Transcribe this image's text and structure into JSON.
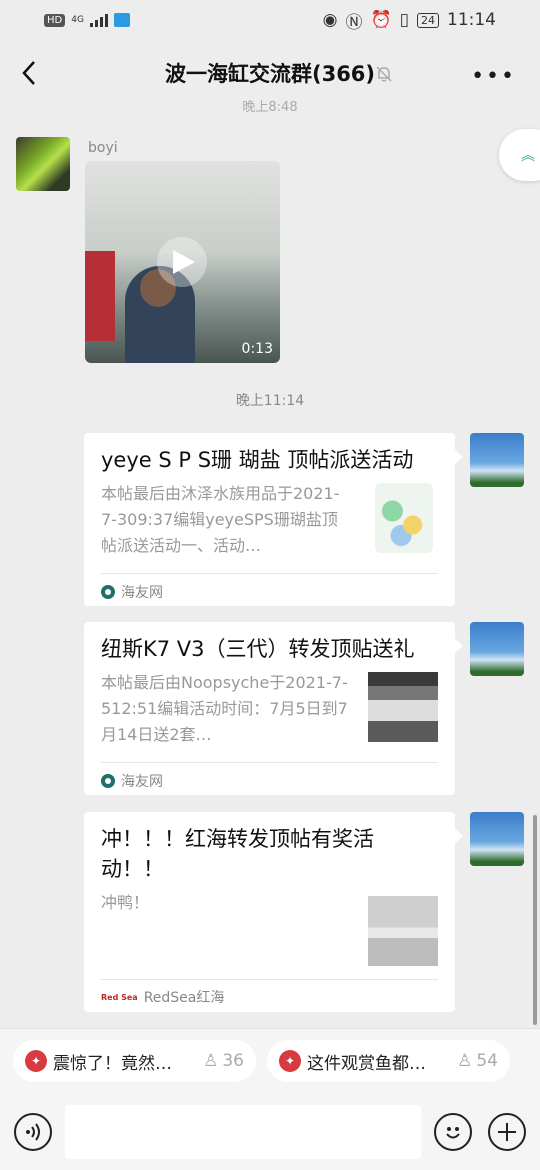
{
  "status": {
    "time": "11:14",
    "battery": "24",
    "hd": "HD",
    "net": "4G"
  },
  "header": {
    "title": "波一海缸交流群(366)"
  },
  "ghost_time": "晚上8:48",
  "messages": {
    "sender": "boyi",
    "video_duration": "0:13",
    "timestamp": "晚上11:14"
  },
  "cards": [
    {
      "title": "yeye S P S珊 瑚盐 顶帖派送活动",
      "desc": "本帖最后由沐泽水族用品于2021-7-309:37编辑yeyeSPS珊瑚盐顶帖派送活动一、活动…",
      "source": "海友网"
    },
    {
      "title": "纽斯K7 V3（三代）转发顶贴送礼",
      "desc": "本帖最后由Noopsyche于2021-7-512:51编辑活动时间：7月5日到7月14日送2套…",
      "source": "海友网"
    },
    {
      "title": "冲！！！红海转发顶帖有奖活动！！",
      "desc": "冲鸭！",
      "source": "RedSea红海"
    }
  ],
  "suggestions": [
    {
      "label": "震惊了！竟然…",
      "count": "36"
    },
    {
      "label": "这件观赏鱼都…",
      "count": "54"
    }
  ],
  "colors": {
    "accent": "#2aae67",
    "hot": "#d93a40",
    "background": "#ededed"
  }
}
